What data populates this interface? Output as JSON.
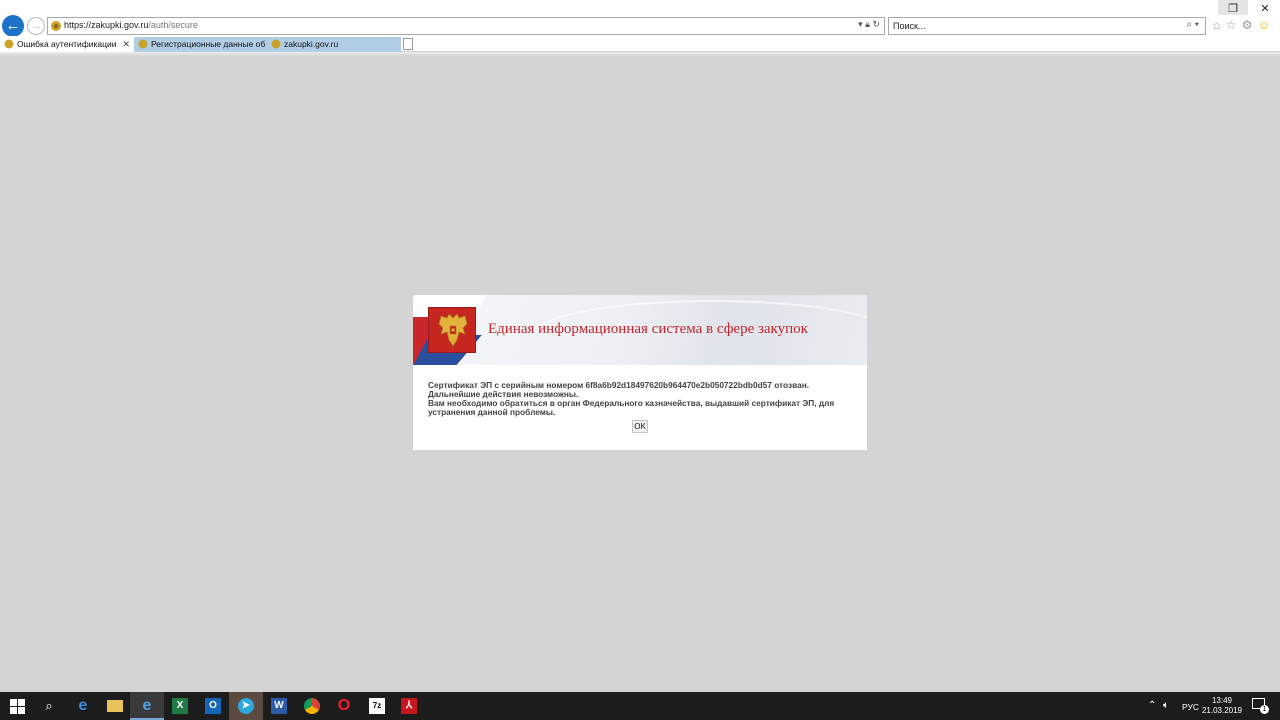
{
  "browser": {
    "address": {
      "host": "https://zakupki.gov.ru",
      "path": "/auth/secure"
    },
    "search": {
      "placeholder": "Поиск..."
    },
    "tabs": [
      {
        "label": "Ошибка аутентификации",
        "active": true
      },
      {
        "label": "Регистрационные данные об ...",
        "active": false
      },
      {
        "label": "zakupki.gov.ru",
        "active": false
      }
    ]
  },
  "dialog": {
    "banner_title": "Единая информационная система в сфере закупок",
    "message_lines": [
      "Сертификат ЭП с серийным номером 6f8a6b92d18497620b964470e2b050722bdb0d57 отозван. Дальнейшие действия невозможны.",
      "Вам необходимо обратиться в орган Федерального казначейства, выдавший сертификат ЭП, для устранения данной проблемы."
    ],
    "ok_label": "OK"
  },
  "taskbar": {
    "apps": [
      {
        "name": "start-icon"
      },
      {
        "name": "search-icon"
      },
      {
        "name": "edge-icon"
      },
      {
        "name": "file-explorer-icon"
      },
      {
        "name": "internet-explorer-icon"
      },
      {
        "name": "excel-icon"
      },
      {
        "name": "outlook-icon"
      },
      {
        "name": "telegram-icon"
      },
      {
        "name": "word-icon"
      },
      {
        "name": "chrome-icon"
      },
      {
        "name": "opera-icon"
      },
      {
        "name": "7zip-icon"
      },
      {
        "name": "acrobat-icon"
      }
    ],
    "language": "РУС",
    "time": "13:49",
    "date": "21.03.2019",
    "notification_count": "1"
  },
  "colors": {
    "page_background": "#d4d4d4",
    "banner_title": "#c0262c",
    "emblem_red": "#c5261f",
    "tab_inactive": "#b2cde6",
    "ie_blue": "#1e73c9"
  }
}
